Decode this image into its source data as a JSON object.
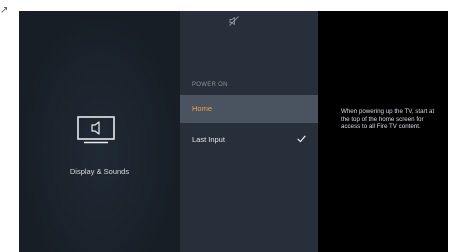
{
  "settings": {
    "category": {
      "label": "Display & Sounds",
      "icon": "tv-speaker-icon"
    },
    "mute_icon": "mute-icon",
    "section_header": "POWER ON",
    "options": [
      {
        "label": "Home",
        "focused": true,
        "checked": false
      },
      {
        "label": "Last Input",
        "focused": false,
        "checked": true
      }
    ],
    "description": "When powering up the TV, start at the top of the home screen for access to all Fire TV content."
  },
  "colors": {
    "background": "#171e26",
    "middle_panel": "#27303a",
    "focused_row": "#4a5360",
    "focused_text": "#f0a33a",
    "right_panel": "#000000"
  }
}
